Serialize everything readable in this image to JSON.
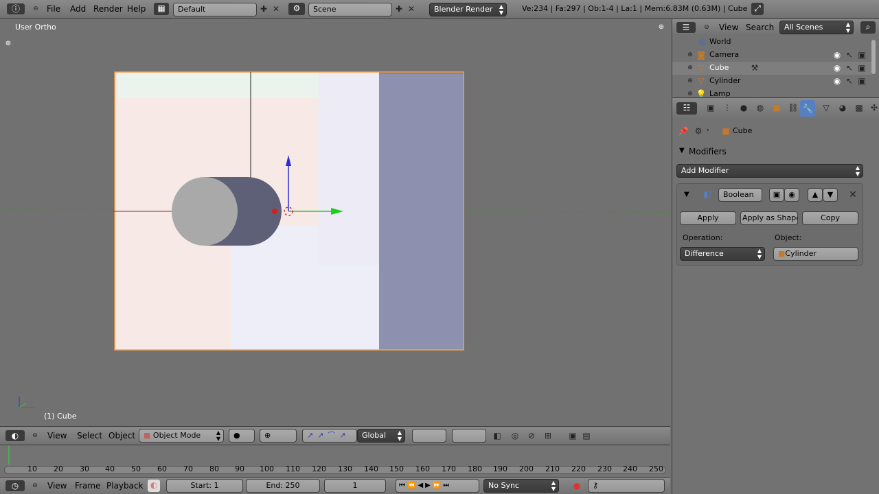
{
  "top_bar": {
    "menus": [
      "File",
      "Add",
      "Render",
      "Help"
    ],
    "screen_layout": "Default",
    "scene": "Scene",
    "renderer": "Blender Render",
    "stats": "Ve:234 | Fa:297 | Ob:1-4 | La:1 | Mem:6.83M (0.63M) | Cube"
  },
  "viewport": {
    "view_name": "User Ortho",
    "object_label": "(1) Cube",
    "header": {
      "menus": [
        "View",
        "Select",
        "Object"
      ],
      "mode": "Object Mode",
      "orientation": "Global"
    }
  },
  "outliner": {
    "menus": [
      "View",
      "Search"
    ],
    "filter": "All Scenes",
    "items": [
      {
        "label": "World"
      },
      {
        "label": "Camera"
      },
      {
        "label": "Cube"
      },
      {
        "label": "Cylinder"
      },
      {
        "label": "Lamp"
      }
    ]
  },
  "properties": {
    "breadcrumb": "Cube",
    "panel_title": "Modifiers",
    "add_modifier": "Add Modifier",
    "modifier": {
      "name": "Boolean",
      "apply": "Apply",
      "apply_as_shape": "Apply as Shape",
      "copy": "Copy",
      "operation_label": "Operation:",
      "operation_value": "Difference",
      "object_label": "Object:",
      "object_value": "Cylinder"
    }
  },
  "timeline": {
    "ticks": [
      "10",
      "20",
      "30",
      "40",
      "50",
      "60",
      "70",
      "80",
      "90",
      "100",
      "110",
      "120",
      "130",
      "140",
      "150",
      "160",
      "170",
      "180",
      "190",
      "200",
      "210",
      "220",
      "230",
      "240",
      "250"
    ],
    "menus": [
      "View",
      "Frame",
      "Playback"
    ],
    "start": "Start: 1",
    "end": "End: 250",
    "current": "1",
    "sync": "No Sync"
  }
}
